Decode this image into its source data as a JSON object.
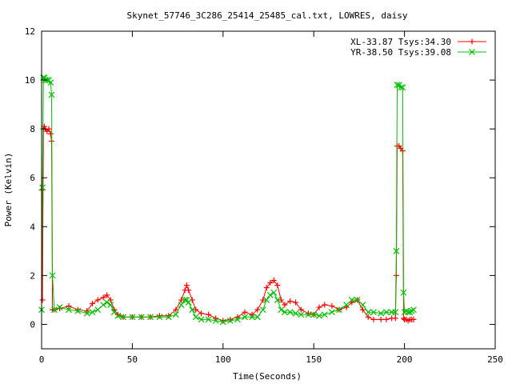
{
  "chart_data": {
    "type": "scatter",
    "title": "Skynet_57746_3C286_25414_25485_cal.txt, LOWRES, daisy",
    "xlabel": "Time(Seconds)",
    "ylabel": "Power (Kelvin)",
    "xlim": [
      0,
      250
    ],
    "ylim": [
      -1,
      12
    ],
    "xticks": [
      0,
      50,
      100,
      150,
      200,
      250
    ],
    "yticks": [
      0,
      2,
      4,
      6,
      8,
      10,
      12
    ],
    "grid": false,
    "legend_position": "top-right",
    "series": [
      {
        "name": "XL-33.87 Tsys:34.30",
        "color": "#ff0000",
        "marker": "plus",
        "x": [
          0,
          0.5,
          1,
          1.5,
          2,
          3,
          4,
          5,
          5.5,
          6,
          7,
          10,
          15,
          20,
          25,
          28,
          31,
          34,
          36,
          38,
          40,
          42,
          45,
          50,
          55,
          60,
          65,
          70,
          74,
          77,
          79,
          80,
          81,
          83,
          85,
          88,
          92,
          96,
          100,
          104,
          108,
          112,
          116,
          119,
          122,
          124,
          126,
          128,
          130,
          132,
          134,
          137,
          140,
          143,
          147,
          150,
          153,
          156,
          160,
          164,
          168,
          171,
          174,
          177,
          180,
          183,
          187,
          190,
          193,
          195,
          195.5,
          196,
          197,
          198,
          199,
          199.5,
          200,
          201,
          202,
          203,
          204,
          205
        ],
        "y": [
          5.5,
          1.0,
          8.0,
          8.1,
          8.0,
          7.9,
          8.0,
          7.8,
          7.5,
          0.6,
          0.6,
          0.65,
          0.75,
          0.6,
          0.55,
          0.85,
          1.0,
          1.1,
          1.2,
          1.0,
          0.6,
          0.4,
          0.3,
          0.3,
          0.3,
          0.3,
          0.35,
          0.35,
          0.6,
          1.0,
          1.4,
          1.6,
          1.4,
          1.0,
          0.6,
          0.45,
          0.4,
          0.25,
          0.15,
          0.2,
          0.3,
          0.5,
          0.4,
          0.6,
          1.0,
          1.5,
          1.7,
          1.8,
          1.6,
          1.0,
          0.8,
          0.95,
          0.9,
          0.6,
          0.45,
          0.4,
          0.7,
          0.8,
          0.75,
          0.6,
          0.7,
          0.9,
          1.0,
          0.6,
          0.3,
          0.2,
          0.2,
          0.2,
          0.25,
          0.25,
          2.0,
          7.3,
          7.3,
          7.2,
          7.1,
          0.25,
          0.2,
          0.2,
          0.15,
          0.2,
          0.2,
          0.2
        ]
      },
      {
        "name": "YR-38.50 Tsys:39.08",
        "color": "#00c000",
        "marker": "cross",
        "x": [
          0,
          0.5,
          1,
          1.5,
          2,
          3,
          4,
          5,
          5.5,
          6,
          7,
          10,
          15,
          20,
          25,
          28,
          31,
          34,
          36,
          38,
          40,
          42,
          45,
          50,
          55,
          60,
          65,
          70,
          74,
          77,
          79,
          80,
          81,
          83,
          85,
          88,
          92,
          96,
          100,
          104,
          108,
          112,
          116,
          119,
          122,
          124,
          126,
          128,
          130,
          132,
          134,
          137,
          140,
          143,
          147,
          150,
          153,
          156,
          160,
          164,
          168,
          171,
          174,
          177,
          180,
          183,
          187,
          190,
          193,
          195,
          195.5,
          196,
          197,
          198,
          199,
          199.5,
          200,
          201,
          202,
          203,
          204,
          205
        ],
        "y": [
          0.6,
          5.6,
          10.1,
          10.1,
          10.0,
          10.0,
          10.0,
          9.9,
          9.4,
          2.0,
          0.6,
          0.7,
          0.6,
          0.55,
          0.45,
          0.5,
          0.6,
          0.8,
          0.9,
          0.8,
          0.5,
          0.35,
          0.3,
          0.3,
          0.3,
          0.3,
          0.3,
          0.3,
          0.4,
          0.8,
          1.0,
          1.0,
          0.9,
          0.6,
          0.3,
          0.2,
          0.2,
          0.15,
          0.1,
          0.15,
          0.2,
          0.3,
          0.3,
          0.3,
          0.6,
          1.0,
          1.2,
          1.3,
          1.0,
          0.6,
          0.5,
          0.5,
          0.45,
          0.4,
          0.4,
          0.4,
          0.35,
          0.4,
          0.5,
          0.6,
          0.8,
          1.0,
          1.0,
          0.8,
          0.5,
          0.5,
          0.45,
          0.5,
          0.5,
          0.5,
          3.0,
          9.8,
          9.8,
          9.7,
          9.7,
          1.3,
          0.5,
          0.55,
          0.5,
          0.5,
          0.55,
          0.6
        ]
      }
    ]
  }
}
